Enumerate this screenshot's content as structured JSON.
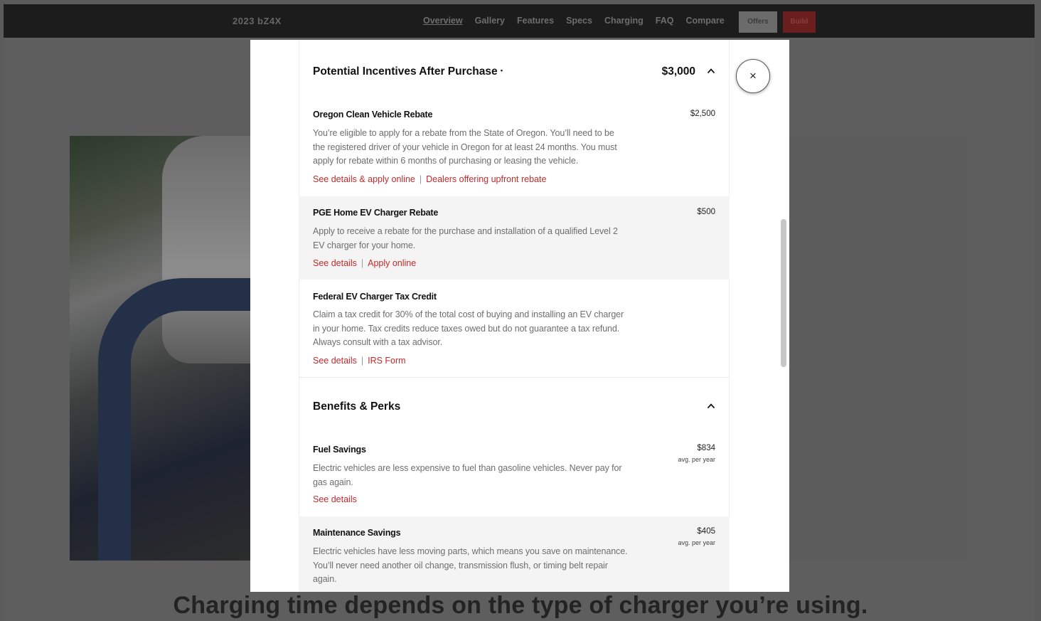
{
  "nav": {
    "model": "2023 bZ4X",
    "links": [
      "Overview",
      "Gallery",
      "Features",
      "Specs",
      "Charging",
      "FAQ",
      "Compare"
    ],
    "offers": "Offers",
    "build": "Build"
  },
  "page": {
    "headline": "Charging time depends on the type of charger you’re using."
  },
  "modal": {
    "close": "×",
    "incentives": {
      "title": "Potential Incentives After Purchase",
      "marker": "•",
      "total": "$3,000",
      "items": [
        {
          "name": "Oregon Clean Vehicle Rebate",
          "value": "$2,500",
          "desc_lines": [
            "You’re eligible to apply for a rebate from the State of Oregon.  You’ll need to be",
            "the registered driver of your vehicle in Oregon for at least 24 months.  You must",
            "apply for rebate within 6 months of purchasing or leasing the vehicle."
          ],
          "link1": "See details & apply online",
          "link2": "Dealers offering upfront rebate"
        },
        {
          "name": "PGE Home EV Charger Rebate",
          "value": "$500",
          "desc_lines": [
            "Apply to receive a rebate for the purchase and installation of a qualified Level 2",
            "EV charger for your home."
          ],
          "link1": "See details",
          "link2": "Apply online"
        },
        {
          "name": "Federal EV Charger Tax Credit",
          "desc_lines": [
            "Claim a tax credit for 30% of the total cost of buying and installing an EV charger",
            "in your home. Tax credits reduce taxes owed but do not guarantee a tax refund.",
            "Always consult with a tax advisor."
          ],
          "link1": "See details",
          "link2": "IRS Form"
        }
      ]
    },
    "benefits": {
      "title": "Benefits & Perks",
      "items": [
        {
          "name": "Fuel Savings",
          "value": "$834",
          "sub": "avg. per year",
          "desc_lines": [
            "Electric vehicles are less expensive to fuel than gasoline vehicles. Never pay for",
            "gas again."
          ],
          "link1": "See details"
        },
        {
          "name": "Maintenance Savings",
          "value": "$405",
          "sub": "avg. per year",
          "desc_lines": [
            "Electric vehicles have less moving parts, which means you save on maintenance.",
            "You’ll never need another oil change, transmission flush, or timing belt repair",
            "again."
          ]
        }
      ]
    }
  },
  "colors": {
    "link_red": "#c32a2a",
    "overlay": "#5b5b5b",
    "shaded_row": "#f4f4f4"
  }
}
